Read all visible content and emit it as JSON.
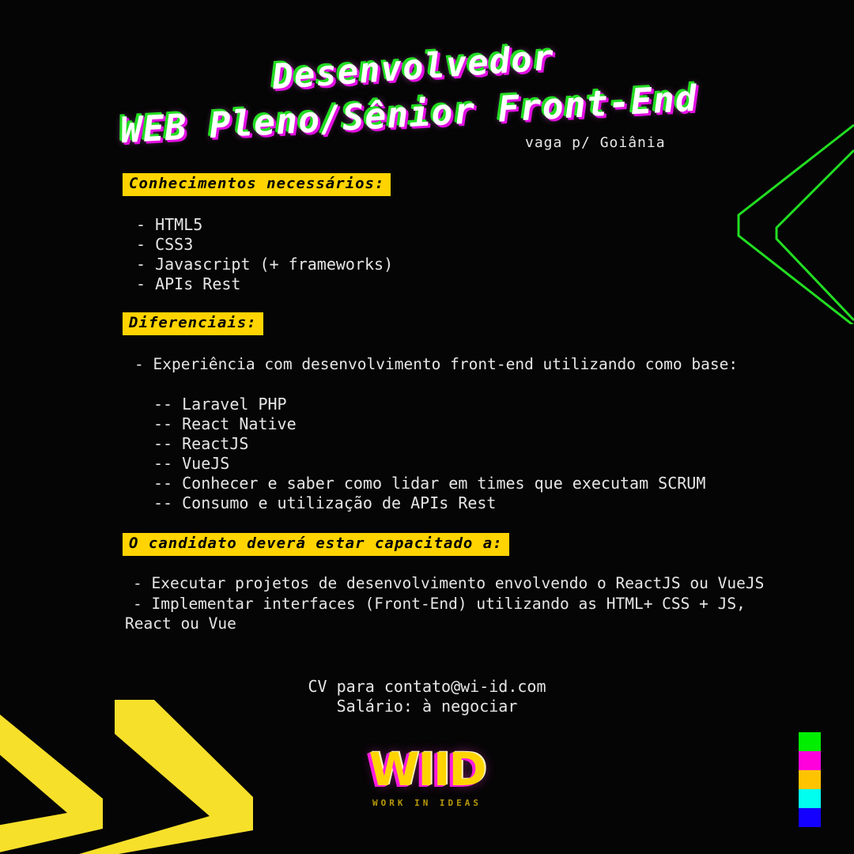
{
  "poster": {
    "background_color": "#050505",
    "accent_yellow": "#ffd400",
    "accent_green": "#22dd22",
    "accent_magenta": "#e210e2"
  },
  "title": {
    "line1": "Desenvolvedor",
    "line2": "WEB Pleno/Sênior Front-End",
    "location_note": "vaga p/ Goiânia"
  },
  "sections": {
    "conhecimentos": {
      "heading": "Conhecimentos necessários:",
      "items": "- HTML5\n- CSS3\n- Javascript (+ frameworks)\n- APIs Rest"
    },
    "diferenciais": {
      "heading": "Diferenciais:",
      "intro": "- Experiência com desenvolvimento front-end utilizando como base:",
      "items": "-- Laravel PHP\n-- React Native\n-- ReactJS\n-- VueJS\n-- Conhecer e saber como lidar em times que executam SCRUM\n-- Consumo e utilização de APIs Rest"
    },
    "capacitado": {
      "heading": "O candidato deverá estar capacitado a:",
      "item1": "- Executar projetos de desenvolvimento envolvendo o ReactJS ou VueJS",
      "item2": "- Implementar interfaces (Front-End) utilizando as HTML+ CSS + JS, React ou Vue"
    }
  },
  "contact": {
    "email_line": "CV para contato@wi-id.com",
    "salary_line": "Salário: à negociar"
  },
  "logo": {
    "mark": "WIID",
    "tagline": "WORK IN IDEAS"
  },
  "swatches": [
    {
      "name": "green",
      "color": "#00ee00"
    },
    {
      "name": "magenta",
      "color": "#ff00dd"
    },
    {
      "name": "gold",
      "color": "#ffc400"
    },
    {
      "name": "cyan",
      "color": "#00ffee"
    },
    {
      "name": "blue",
      "color": "#1400ff"
    }
  ]
}
